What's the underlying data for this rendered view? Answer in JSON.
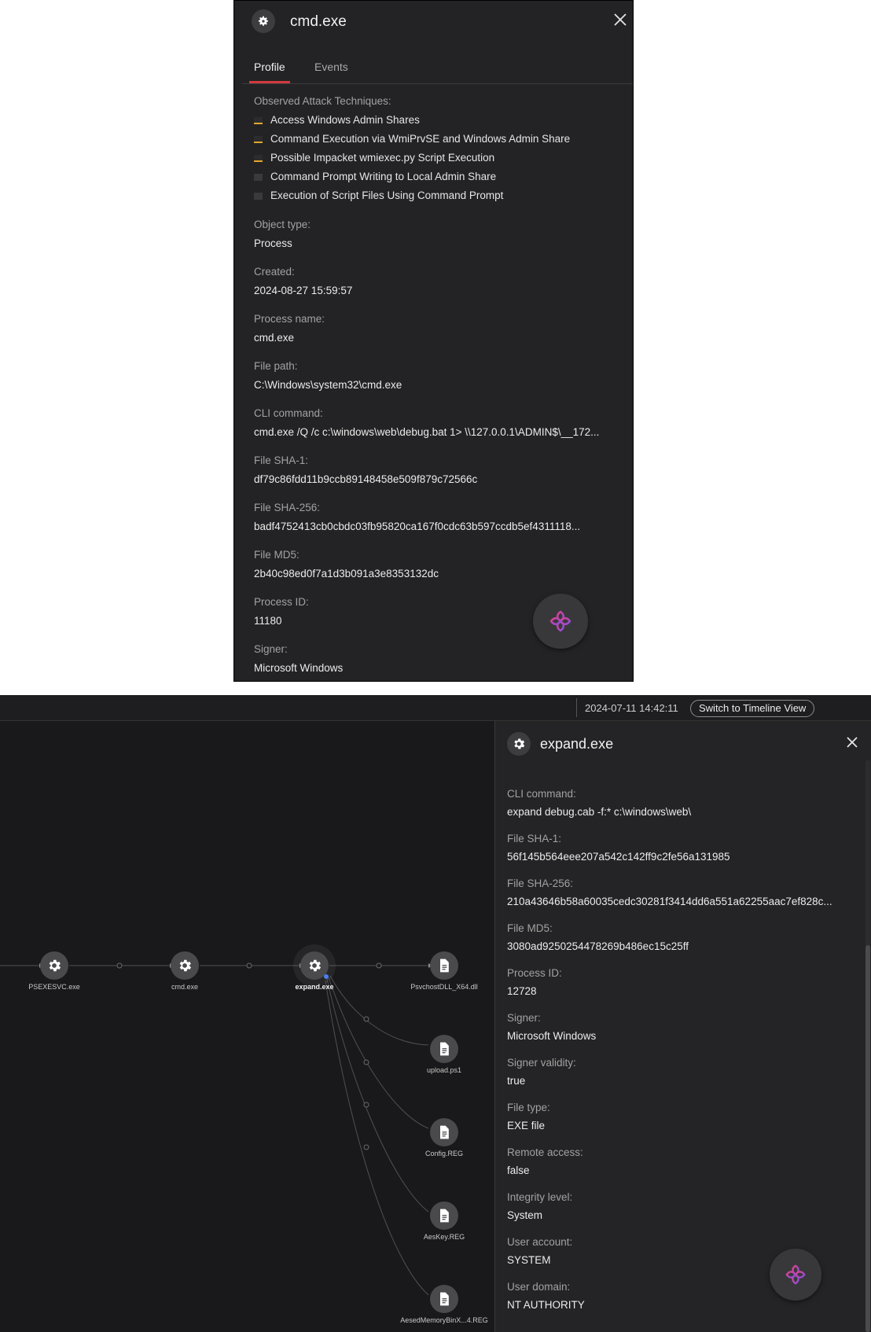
{
  "top_panel": {
    "title": "cmd.exe",
    "tabs": [
      {
        "label": "Profile",
        "active": true
      },
      {
        "label": "Events",
        "active": false
      }
    ],
    "techniques_label": "Observed Attack Techniques:",
    "techniques": [
      {
        "label": "Access Windows Admin Shares",
        "severity": "warning"
      },
      {
        "label": "Command Execution via WmiPrvSE and Windows Admin Share",
        "severity": "warning"
      },
      {
        "label": "Possible Impacket wmiexec.py Script Execution",
        "severity": "warning"
      },
      {
        "label": "Command Prompt Writing to Local Admin Share",
        "severity": "low"
      },
      {
        "label": "Execution of Script Files Using Command Prompt",
        "severity": "low"
      }
    ],
    "fields": [
      {
        "label": "Object type:",
        "value": "Process"
      },
      {
        "label": "Created:",
        "value": "2024-08-27 15:59:57"
      },
      {
        "label": "Process name:",
        "value": "cmd.exe"
      },
      {
        "label": "File path:",
        "value": "C:\\Windows\\system32\\cmd.exe"
      },
      {
        "label": "CLI command:",
        "value": "cmd.exe /Q /c c:\\windows\\web\\debug.bat 1> \\\\127.0.0.1\\ADMIN$\\__172..."
      },
      {
        "label": "File SHA-1:",
        "value": "df79c86fdd11b9ccb89148458e509f879c72566c"
      },
      {
        "label": "File SHA-256:",
        "value": "badf4752413cb0cbdc03fb95820ca167f0cdc63b597ccdb5ef4311118..."
      },
      {
        "label": "File MD5:",
        "value": "2b40c98ed0f7a1d3b091a3e8353132dc"
      },
      {
        "label": "Process ID:",
        "value": "11180"
      },
      {
        "label": "Signer:",
        "value": "Microsoft Windows"
      }
    ]
  },
  "bottom": {
    "timestamp": "2024-07-11 14:42:11",
    "switch_button": "Switch to Timeline View",
    "graph": {
      "nodes": [
        {
          "label": "PSEXESVC.exe"
        },
        {
          "label": "cmd.exe"
        },
        {
          "label": "expand.exe"
        },
        {
          "label": "PsvchostDLL_X64.dll"
        },
        {
          "label": "upload.ps1"
        },
        {
          "label": "Config.REG"
        },
        {
          "label": "AesKey.REG"
        },
        {
          "label": "AesedMemoryBinX...4.REG"
        }
      ]
    },
    "panel": {
      "title": "expand.exe",
      "fields": [
        {
          "label": "CLI command:",
          "value": "expand debug.cab -f:* c:\\windows\\web\\"
        },
        {
          "label": "File SHA-1:",
          "value": "56f145b564eee207a542c142ff9c2fe56a131985"
        },
        {
          "label": "File SHA-256:",
          "value": "210a43646b58a60035cedc30281f3414dd6a551a62255aac7ef828c..."
        },
        {
          "label": "File MD5:",
          "value": "3080ad9250254478269b486ec15c25ff"
        },
        {
          "label": "Process ID:",
          "value": "12728"
        },
        {
          "label": "Signer:",
          "value": "Microsoft Windows"
        },
        {
          "label": "Signer validity:",
          "value": "true"
        },
        {
          "label": "File type:",
          "value": "EXE file"
        },
        {
          "label": "Remote access:",
          "value": "false"
        },
        {
          "label": "Integrity level:",
          "value": "System"
        },
        {
          "label": "User account:",
          "value": "SYSTEM"
        },
        {
          "label": "User domain:",
          "value": "NT AUTHORITY"
        }
      ]
    }
  },
  "colors": {
    "panel_bg": "#232325",
    "tab_accent": "#d13a3e",
    "technique_warning": "#e0a72c",
    "ai_gradient_a": "#e0408a",
    "ai_gradient_b": "#8a4fe0"
  }
}
